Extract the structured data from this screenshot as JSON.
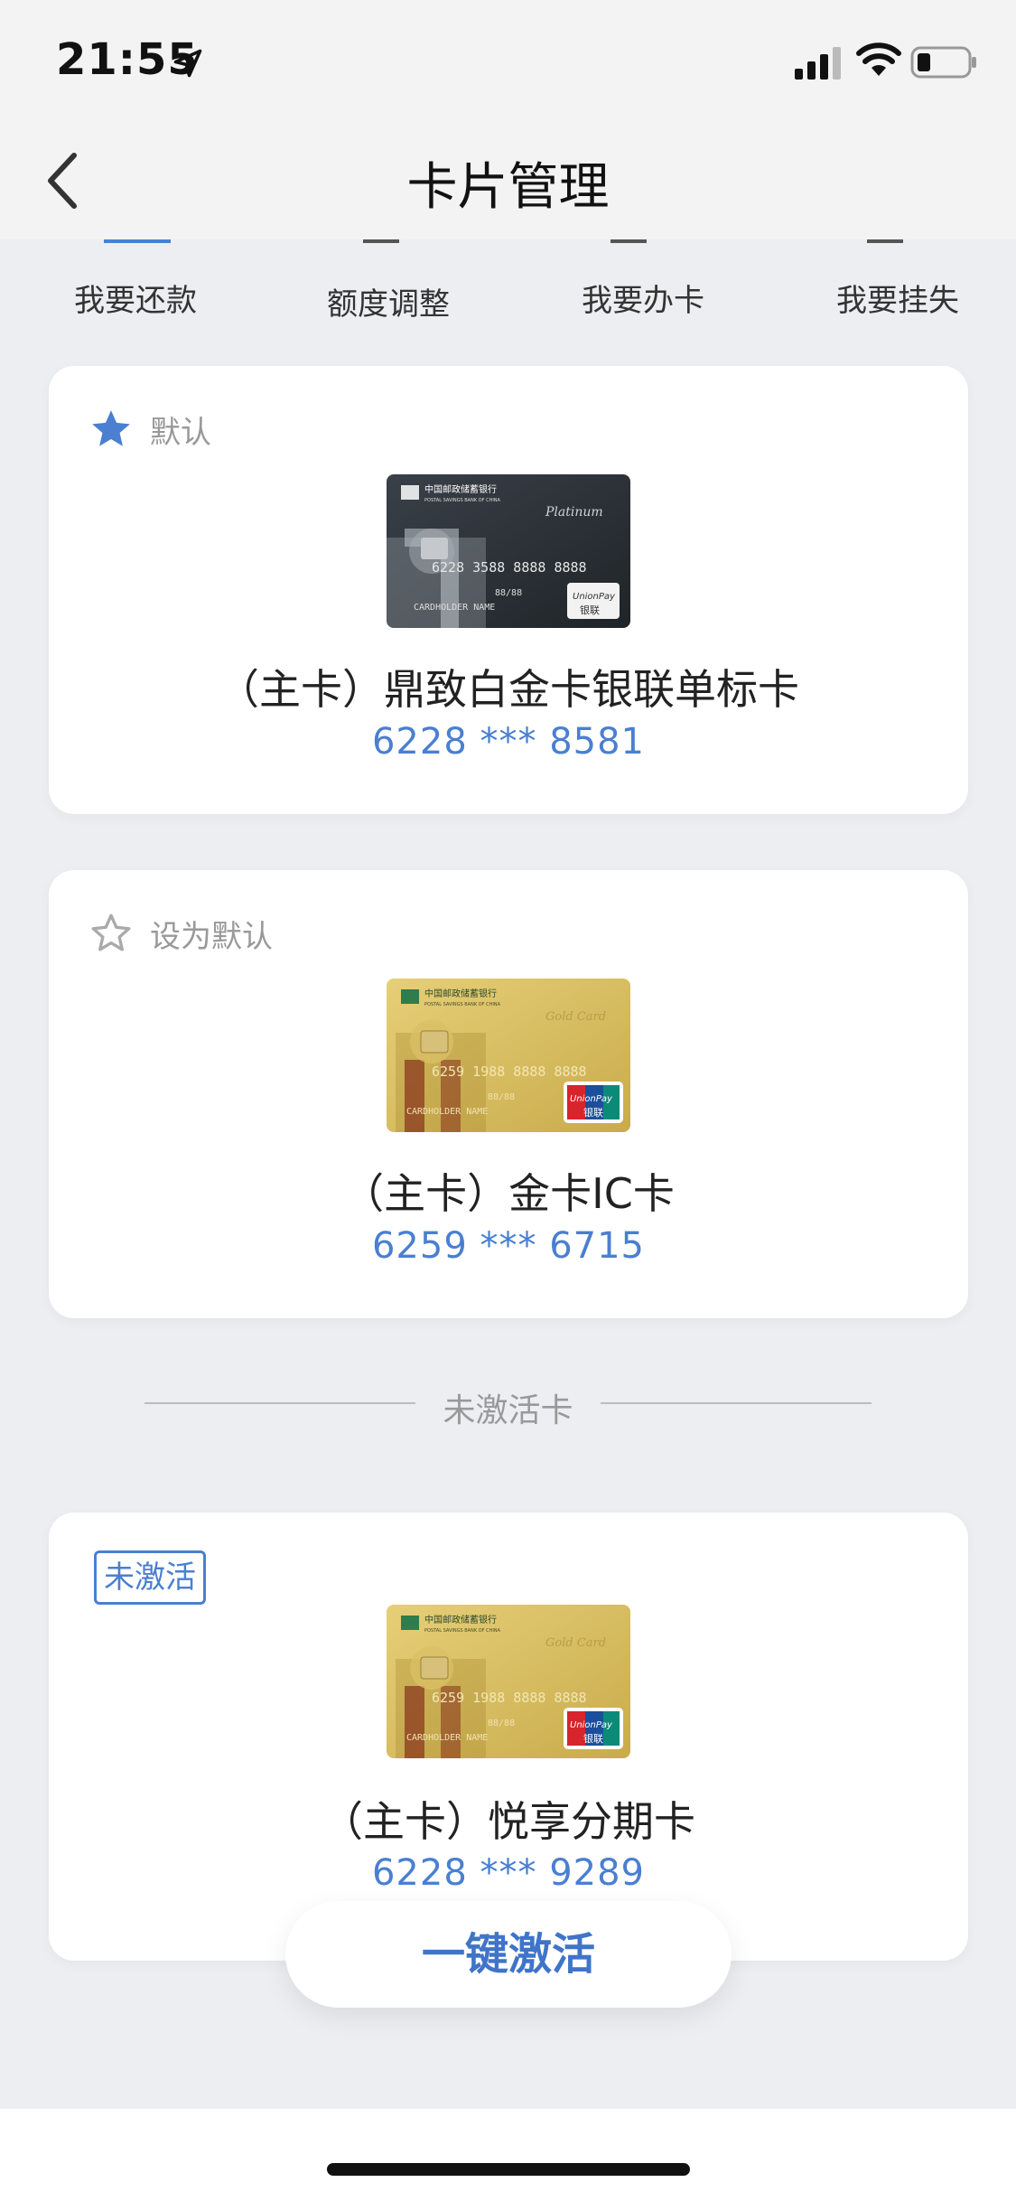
{
  "status_bar": {
    "time": "21:55"
  },
  "nav": {
    "title": "卡片管理"
  },
  "quick_actions": [
    {
      "label": "我要还款"
    },
    {
      "label": "额度调整"
    },
    {
      "label": "我要办卡"
    },
    {
      "label": "我要挂失"
    }
  ],
  "cards": [
    {
      "tag": "默认",
      "name": "（主卡）鼎致白金卡银联单标卡",
      "number": "6228 *** 8581",
      "card_style": "platinum"
    },
    {
      "tag": "设为默认",
      "name": "（主卡）金卡IC卡",
      "number": "6259 *** 6715",
      "card_style": "gold"
    }
  ],
  "divider": {
    "label": "未激活卡"
  },
  "inactive_cards": [
    {
      "badge": "未激活",
      "name": "（主卡）悦享分期卡",
      "number": "6228 *** 9289",
      "card_style": "gold"
    }
  ],
  "activate_button": {
    "label": "一键激活"
  },
  "colors": {
    "accent": "#4a7fd1",
    "background": "#eceef1"
  },
  "card_art": {
    "platinum": {
      "bank": "中国邮政储蓄银行",
      "bank_en": "POSTAL SAVINGS BANK OF CHINA",
      "type": "Platinum",
      "number": "6228 3588 8888 8888",
      "holder": "CARDHOLDER NAME",
      "expiry": "88/88",
      "network": "UnionPay",
      "network_cn": "银联"
    },
    "gold": {
      "bank": "中国邮政储蓄银行",
      "bank_en": "POSTAL SAVINGS BANK OF CHINA",
      "type": "Gold Card",
      "number": "6259 1988 8888 8888",
      "holder": "CARDHOLDER NAME",
      "expiry": "88/88",
      "network": "UnionPay",
      "network_cn": "银联"
    },
    "gold2": {
      "number": "6259 1988 8888 8888"
    }
  }
}
